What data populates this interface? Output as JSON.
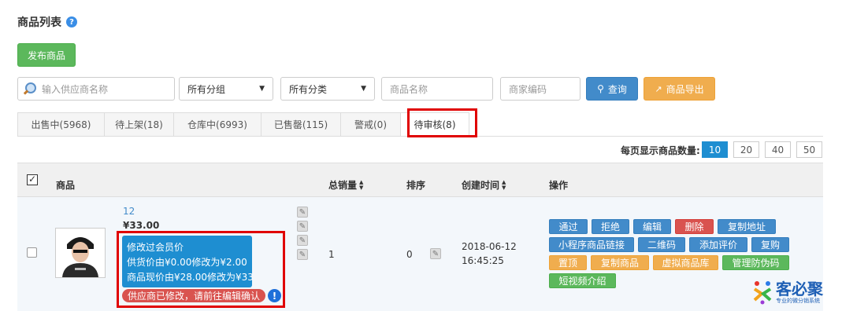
{
  "page": {
    "title": "商品列表",
    "help_icon": "?"
  },
  "toolbar": {
    "publish_label": "发布商品"
  },
  "filters": {
    "supplier_placeholder": "输入供应商名称",
    "group_value": "所有分组",
    "category_value": "所有分类",
    "product_name_placeholder": "商品名称",
    "merchant_code_placeholder": "商家编码",
    "search_label": "查询",
    "export_label": "商品导出"
  },
  "tabs": [
    {
      "label": "出售中(5968)"
    },
    {
      "label": "待上架(18)"
    },
    {
      "label": "仓库中(6993)"
    },
    {
      "label": "已售罄(115)"
    },
    {
      "label": "警戒(0)"
    },
    {
      "label": "待审核(8)",
      "active": true
    }
  ],
  "pagination": {
    "label": "每页显示商品数量:",
    "options": [
      "10",
      "20",
      "40",
      "50"
    ],
    "selected": "10"
  },
  "table": {
    "headers": {
      "product": "商品",
      "total_sales": "总销量",
      "sort": "排序",
      "created": "创建时间",
      "actions": "操作"
    },
    "rows": [
      {
        "name": "12",
        "price": "¥33.00",
        "tooltip": [
          "修改过会员价",
          "供货价由¥0.00修改为¥2.00",
          "商品现价由¥28.00修改为¥33"
        ],
        "warning": "供应商已修改，请前往编辑确认",
        "info_icon": "!",
        "total_sales": "1",
        "sort": "0",
        "created_date": "2018-06-12",
        "created_time": "16:45:25",
        "actions": [
          [
            "通过",
            "拒绝",
            "编辑",
            "删除",
            "复制地址"
          ],
          [
            "小程序商品链接",
            "二维码",
            "添加评价",
            "复购"
          ],
          [
            "置顶",
            "复制商品",
            "虚拟商品库",
            "管理防伪码"
          ],
          [
            "短视频介绍"
          ]
        ]
      }
    ]
  },
  "watermark": {
    "name": "客必聚",
    "tagline": "专业的微分销系统"
  },
  "colors": {
    "primary": "#428bca",
    "success": "#5cb85c",
    "warning": "#f0ad4e",
    "danger": "#d9534f",
    "highlight": "#e00000",
    "tooltip": "#1e8ed1"
  }
}
